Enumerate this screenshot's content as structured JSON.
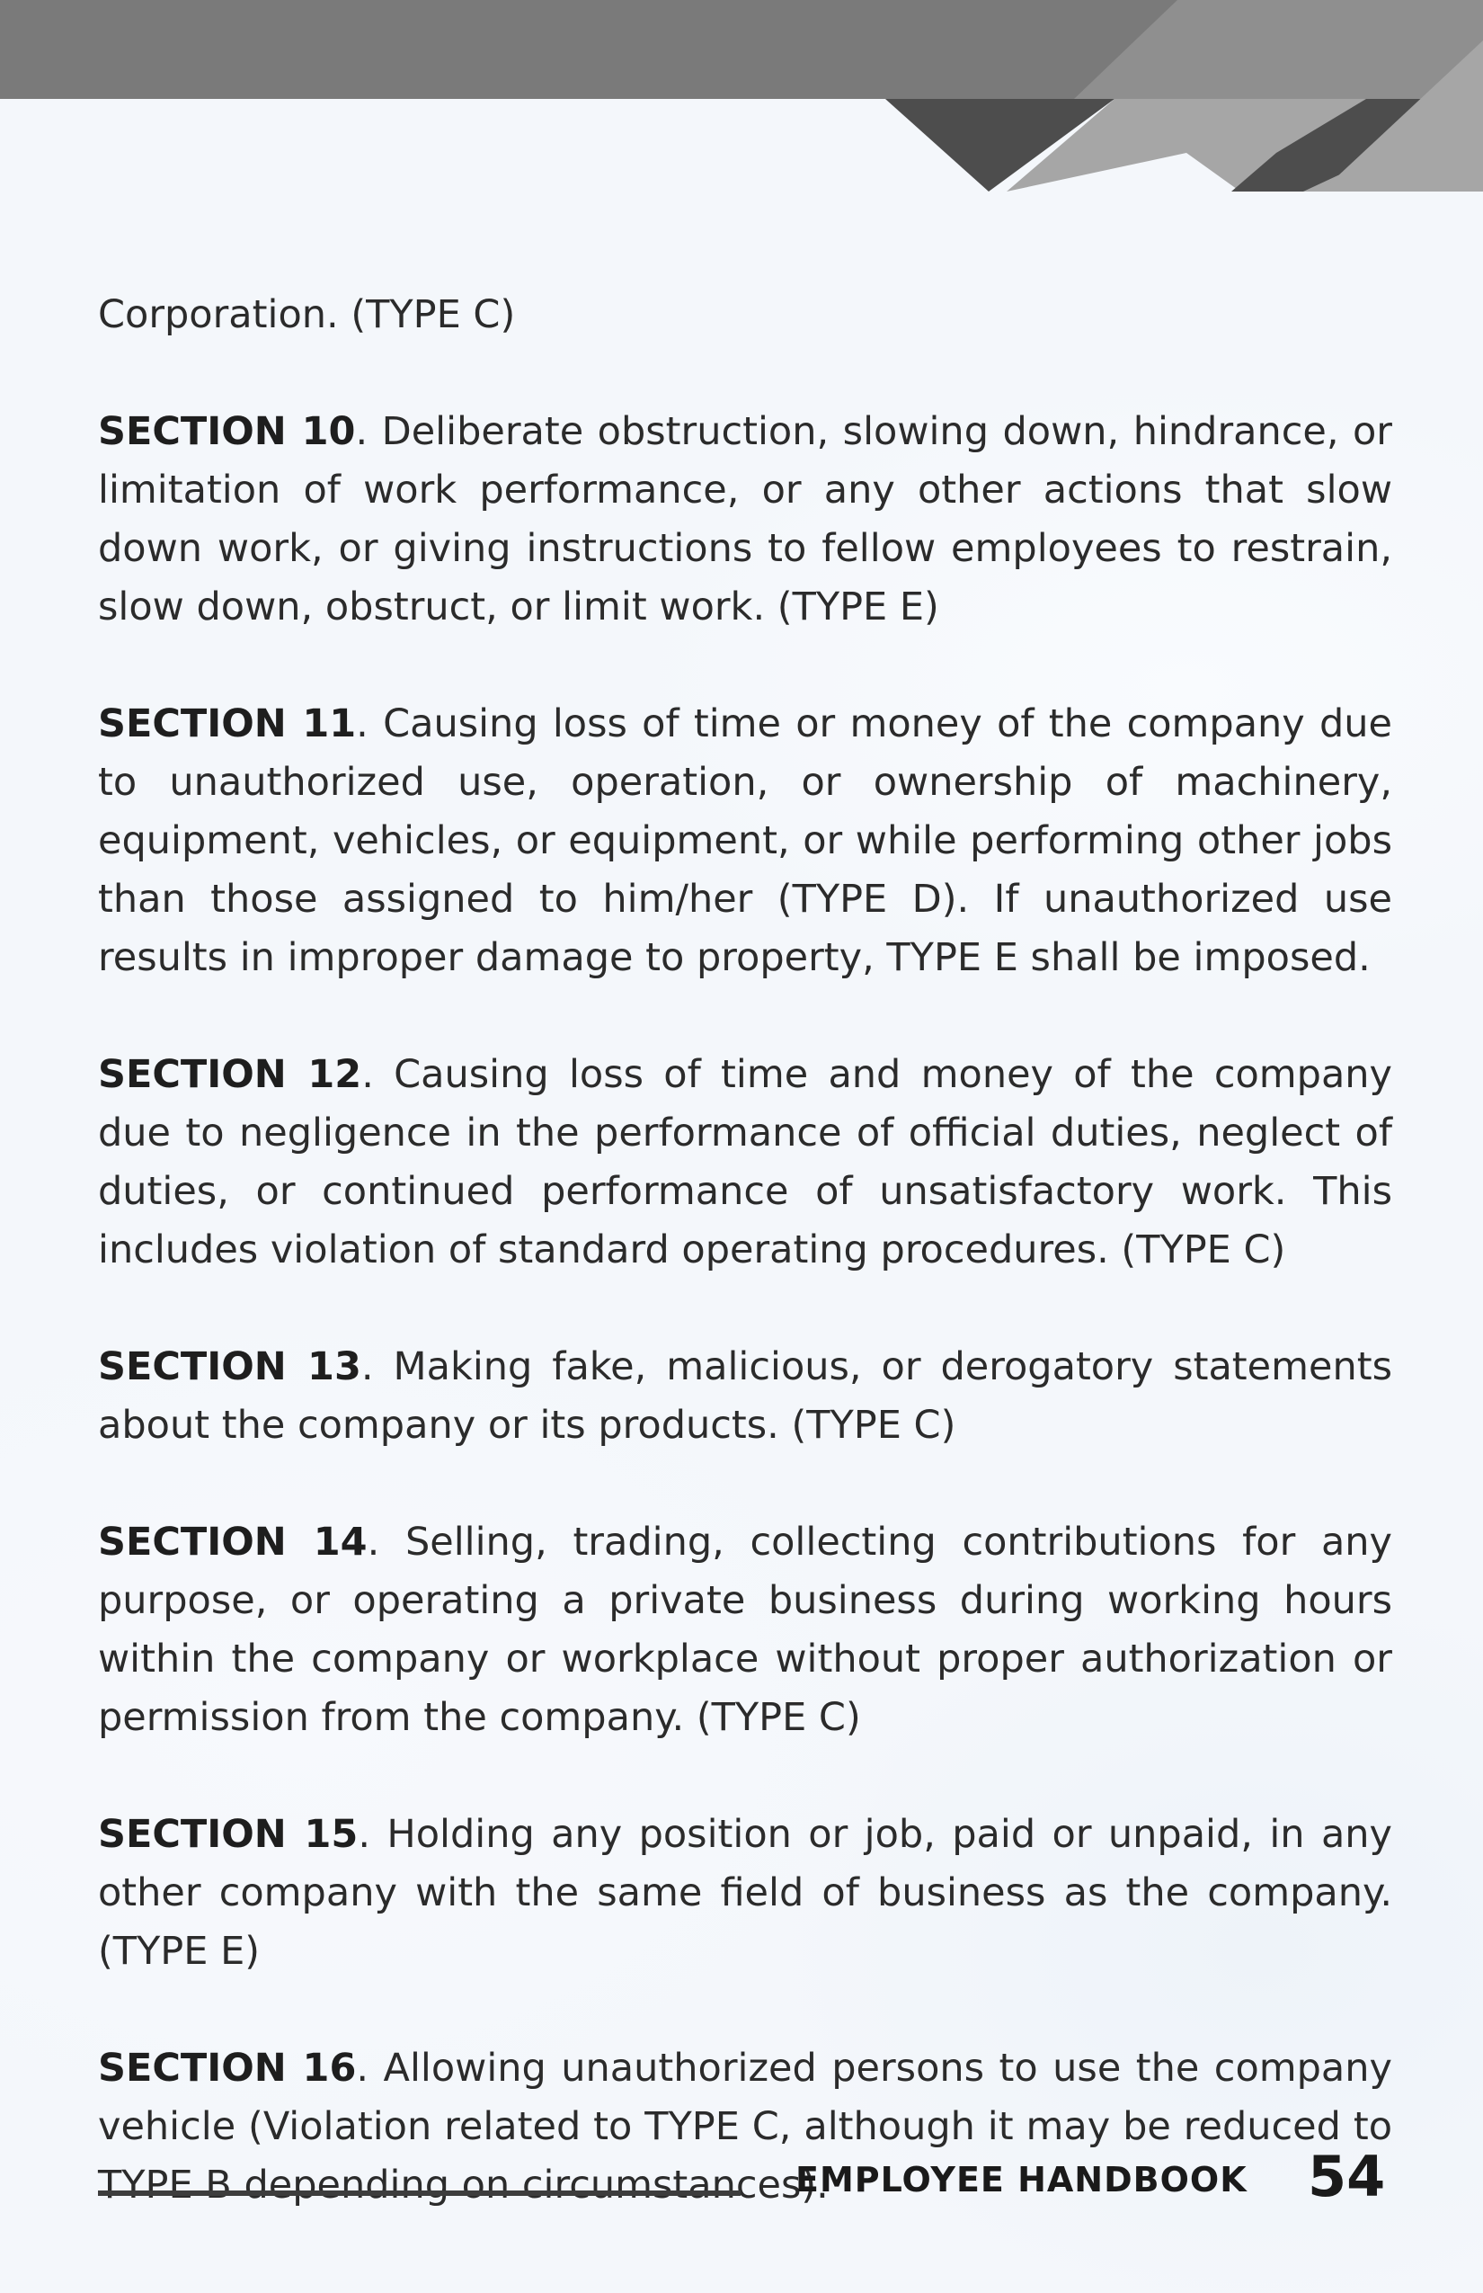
{
  "lead_text": "Corporation. (TYPE C)",
  "sections": [
    {
      "title": "SECTION 10",
      "body": ". Deliberate obstruction, slowing down, hindrance, or limitation of work performance, or any other actions that slow down work, or giving instructions to fellow employees to restrain, slow down, obstruct, or limit work. (TYPE E)"
    },
    {
      "title": "SECTION 11",
      "body": ". Causing loss of time or money of the company due to unauthorized use, operation, or ownership of machinery, equipment, vehicles, or equipment, or while performing other jobs than those assigned to him/her (TYPE D). If unauthorized use results in improper damage to property, TYPE E shall be imposed."
    },
    {
      "title": "SECTION 12",
      "body": ". Causing loss of time and money of the company due to negligence in the performance of official duties, neglect of duties, or continued performance of unsatisfactory work. This includes violation of standard operating procedures. (TYPE C)"
    },
    {
      "title": "SECTION 13",
      "body": ". Making fake, malicious, or derogatory statements about the company or its products. (TYPE C)"
    },
    {
      "title": "SECTION 14",
      "body": ". Selling, trading, collecting contributions for any purpose, or operating a private business during working hours within the company or workplace without proper authorization or permission from the company. (TYPE C)"
    },
    {
      "title": "SECTION 15",
      "body": ". Holding any position or job, paid or unpaid, in any other company with the same field of business as the company. (TYPE E)"
    },
    {
      "title": "SECTION 16",
      "body": ". Allowing unauthorized persons to use the company vehicle (Violation related to TYPE C, although it may be reduced to TYPE B depending on circumstances)."
    }
  ],
  "footer": {
    "title": "EMPLOYEE HANDBOOK",
    "page_number": "54"
  },
  "colors": {
    "header_band": "#7a7a7a",
    "stripe_dark": "#4d4d4d",
    "stripe_light": "#a6a6a6",
    "text": "#2b2b2b"
  }
}
